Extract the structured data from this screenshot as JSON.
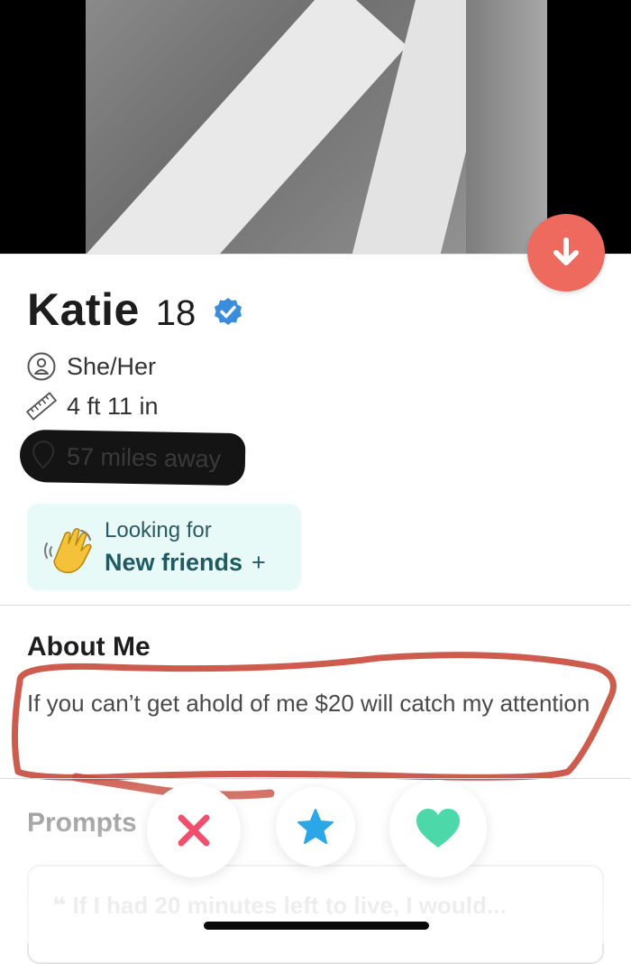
{
  "profile": {
    "name": "Katie",
    "age": "18",
    "pronouns": "She/Her",
    "height": "4 ft 11 in",
    "distance": "57 miles away"
  },
  "looking_for": {
    "label": "Looking for",
    "value": "New friends",
    "plus": "+"
  },
  "about": {
    "title": "About Me",
    "text": "If you can’t get ahold of me $20 will catch my attention"
  },
  "prompts": {
    "title": "Prompts",
    "first_prompt": "❝ If I had 20 minutes left to live, I would..."
  },
  "icons": {
    "down": "arrow-down-icon",
    "verified": "verified-badge-icon",
    "pronouns": "person-icon",
    "height": "ruler-icon",
    "distance": "location-pin-icon",
    "looking_for": "waving-hand-icon",
    "nope": "x-icon",
    "super_like": "star-icon",
    "like": "heart-icon"
  },
  "colors": {
    "accent_red": "#ee6a5f",
    "verified_blue": "#3a8ddd",
    "super_like_blue": "#2ba7e8",
    "like_teal": "#4dd8a9",
    "nope_red": "#f0506e",
    "looking_bg": "#e8faf8",
    "annotation_red": "#c84a3b"
  }
}
